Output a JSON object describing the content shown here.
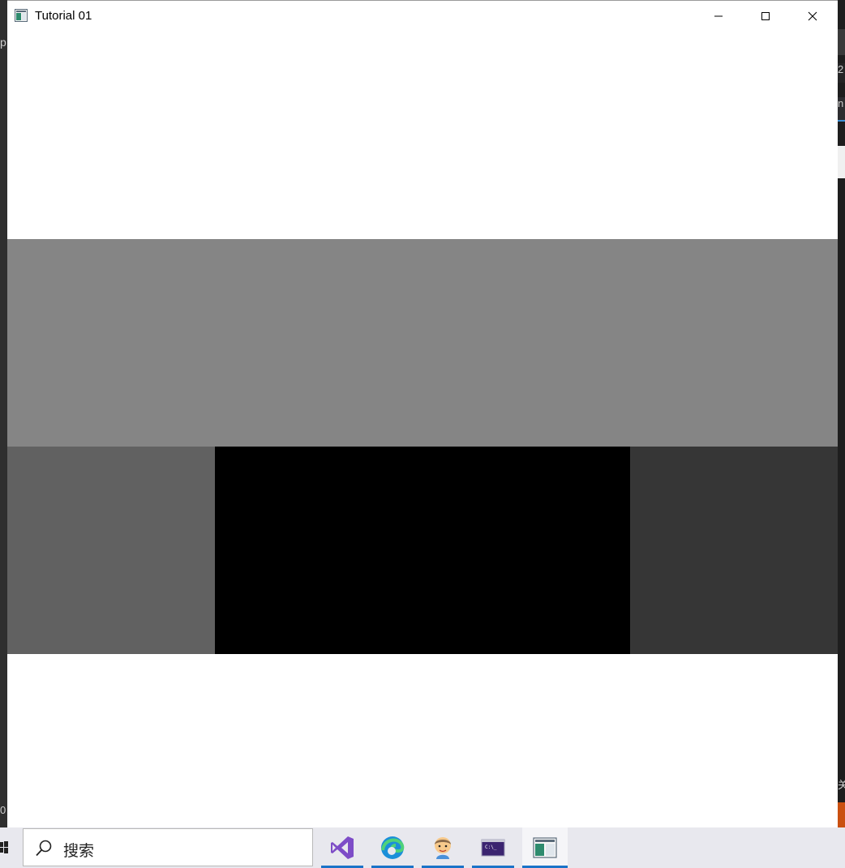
{
  "window": {
    "title": "Tutorial 01",
    "controls": {
      "minimize": "minimize",
      "maximize": "maximize",
      "close": "close"
    }
  },
  "viewport_tiles": [
    {
      "name": "gray-band",
      "color": "#858585"
    },
    {
      "name": "dark-gray-tile-left",
      "color": "#616161"
    },
    {
      "name": "black-tile-center",
      "color": "#000000"
    },
    {
      "name": "charcoal-tile-right",
      "color": "#363636"
    }
  ],
  "background": {
    "left_text": "p",
    "left_bottom_text": "0",
    "right_text_1": "2",
    "right_text_2": "n",
    "right_text_3": "关"
  },
  "taskbar": {
    "search": {
      "placeholder": "搜索"
    },
    "apps": [
      {
        "name": "visual-studio",
        "icon": "visual-studio-icon",
        "active": false
      },
      {
        "name": "edge",
        "icon": "edge-icon",
        "active": false
      },
      {
        "name": "avatar-app",
        "icon": "avatar-icon",
        "active": false
      },
      {
        "name": "terminal",
        "icon": "terminal-icon",
        "active": false
      },
      {
        "name": "tutorial-01",
        "icon": "app-window-icon",
        "active": true
      }
    ]
  }
}
